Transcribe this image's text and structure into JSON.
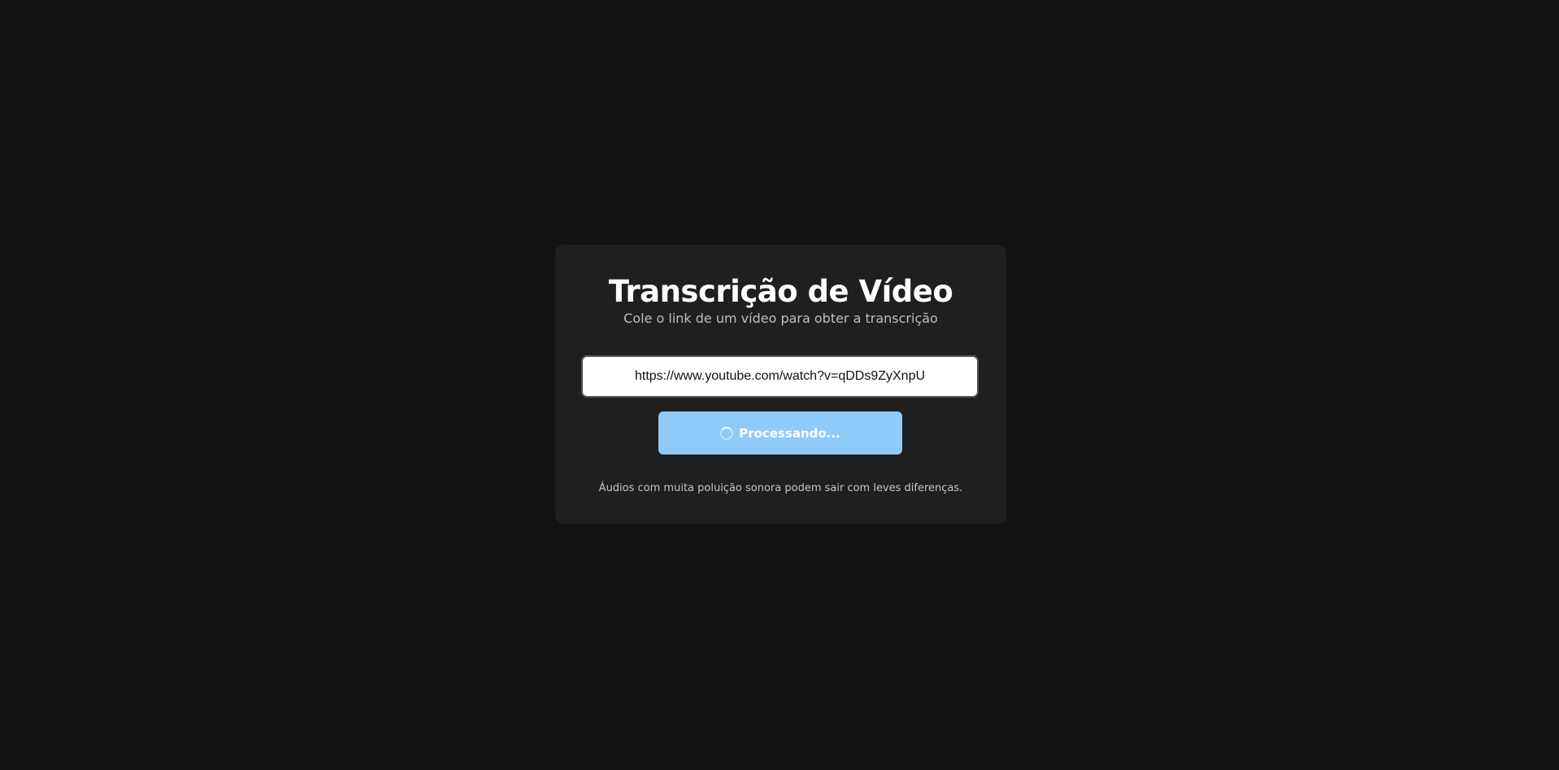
{
  "header": {
    "title": "Transcrição de Vídeo",
    "subtitle": "Cole o link de um vídeo para obter a transcrição"
  },
  "form": {
    "url_value": "https://www.youtube.com/watch?v=qDDs9ZyXnpU",
    "button_label": "Processando...",
    "button_icon": "spinner-icon"
  },
  "footer": {
    "note": "Áudios com muita poluição sonora podem sair com leves diferenças."
  },
  "colors": {
    "background": "#131313",
    "card": "#1f1f1f",
    "button": "#90caf9",
    "input_background": "#ffffff"
  }
}
